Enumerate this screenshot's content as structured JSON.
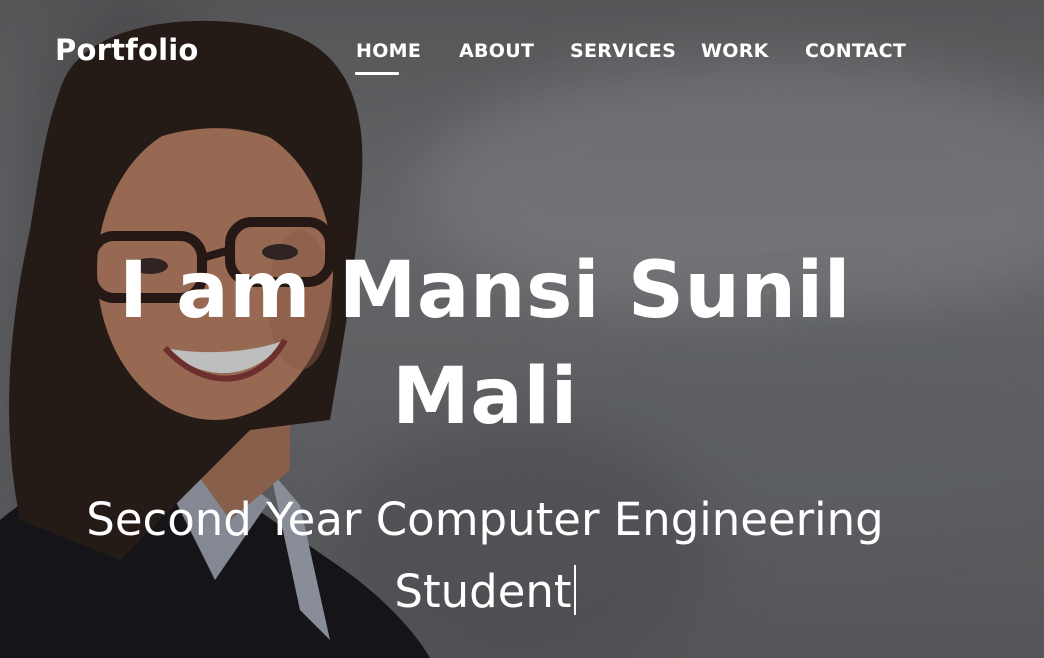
{
  "nav": {
    "brand": "Portfolio",
    "items": [
      {
        "label": "HOME",
        "active": true
      },
      {
        "label": "ABOUT"
      },
      {
        "label": "SERVICES"
      },
      {
        "label": "WORK"
      },
      {
        "label": "CONTACT"
      }
    ]
  },
  "hero": {
    "headline": "I am Mansi Sunil Mali",
    "subtitle": "Second Year Computer Engineering Student",
    "background_image": "portrait-photo",
    "overlay_color": "#141418"
  },
  "colors": {
    "text": "#ffffff",
    "skin": "#c98a6a",
    "hair": "#2a1c16",
    "jacket": "#141418",
    "collar": "#aeb4c2"
  }
}
